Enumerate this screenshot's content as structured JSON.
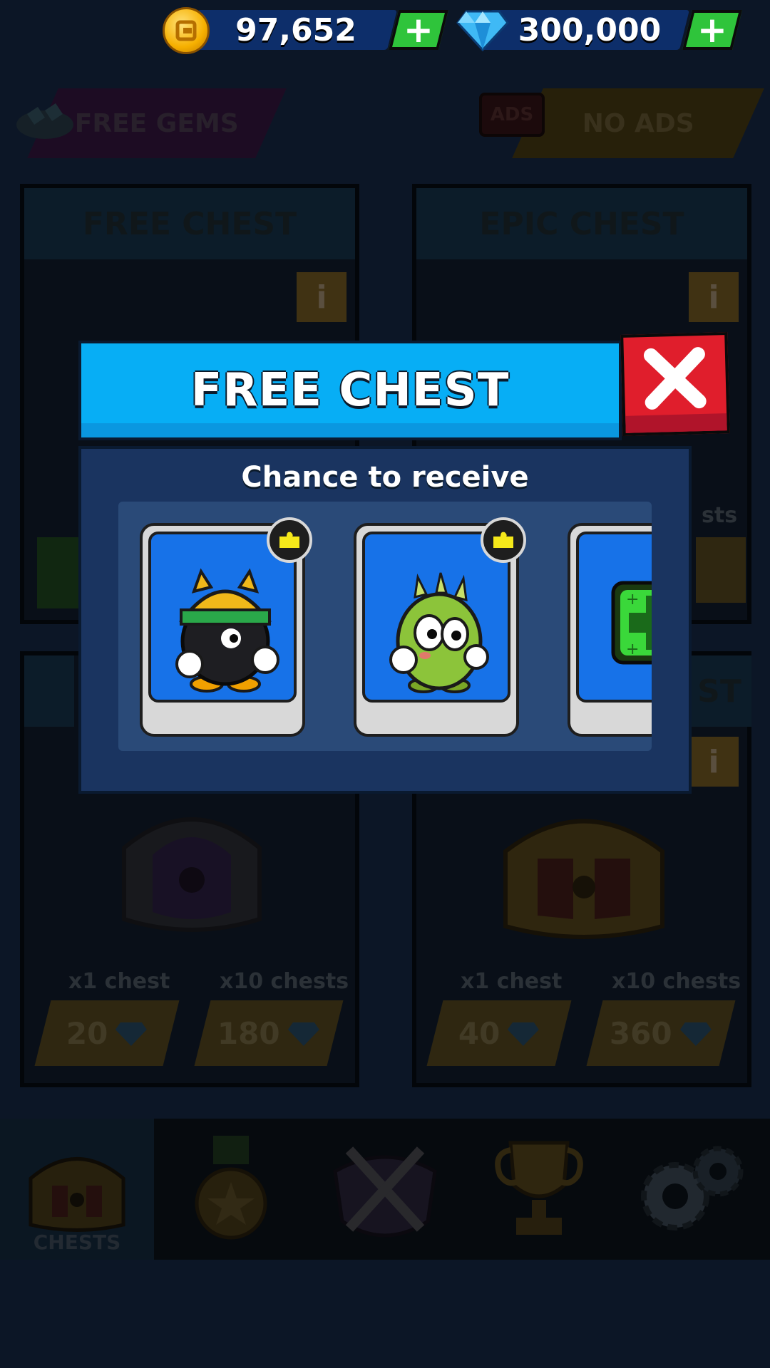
{
  "currency": {
    "coins": "97,652",
    "gems": "300,000",
    "coin_icon": "coin-icon",
    "gem_icon": "gem-icon"
  },
  "banners": {
    "free_gems": "FREE GEMS",
    "ads_badge": "ADS",
    "no_ads": "NO ADS"
  },
  "panels": {
    "free_chest": "FREE CHEST",
    "epic_chest": "EPIC CHEST",
    "partial_chests": "sts",
    "partial_st": "ST",
    "left_bottom": {
      "x1_label": "x1 chest",
      "x10_label": "x10 chests",
      "x1_price": "20",
      "x10_price": "180"
    },
    "right_bottom": {
      "x1_label": "x1 chest",
      "x10_label": "x10 chests",
      "x1_price": "40",
      "x10_price": "360"
    },
    "info_label": "i"
  },
  "nav": {
    "tabs": [
      {
        "label": "CHESTS",
        "icon": "chest-icon",
        "active": true
      },
      {
        "label": "",
        "icon": "medal-icon",
        "active": false
      },
      {
        "label": "",
        "icon": "crossed-swords-icon",
        "active": false
      },
      {
        "label": "",
        "icon": "trophy-icon",
        "active": false
      },
      {
        "label": "",
        "icon": "gears-icon",
        "active": false
      }
    ]
  },
  "modal": {
    "title": "FREE CHEST",
    "subtitle": "Chance to receive",
    "close_icon": "close-icon",
    "rewards": [
      {
        "name": "helmet-bomb-character",
        "badge_icon": "puzzle-piece-icon"
      },
      {
        "name": "cactus-character",
        "badge_icon": "puzzle-piece-icon"
      },
      {
        "name": "health-boost-item",
        "badge_icon": ""
      }
    ]
  },
  "colors": {
    "title_bar": "#07aef5",
    "close_button": "#e01e2c",
    "modal_body": "#1a3460",
    "card_bg": "#1772e8",
    "plus_button": "#2fc43b"
  }
}
